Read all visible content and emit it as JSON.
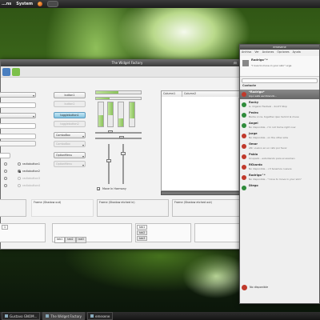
{
  "top_panel": {
    "menu_items": [
      "...ns",
      "System"
    ]
  },
  "taskbar": {
    "items": [
      {
        "label": "Gustavo GNOM..."
      },
      {
        "label": "The Widget Factory"
      },
      {
        "label": "emesene"
      }
    ]
  },
  "widget_factory": {
    "title": "The Widget Factory",
    "buttons": {
      "button1": "button1",
      "button2": "button2",
      "toggle1": "togglebutton1",
      "toggle2": "togglebutton2",
      "combo1": "ComboBox",
      "combo2": "ComboBox",
      "option1": "OptionMenu",
      "option2": "OptionMenu"
    },
    "radios": [
      "radiobutton1",
      "radiobutton2",
      "radiobutton3",
      "radiobutton4"
    ],
    "radio_selected_index": 1,
    "list_columns": [
      "Column1",
      "Column2"
    ],
    "move_checkbox": "Move In Harmony",
    "frames": [
      "Frame (Shadow out)",
      "Frame (Shadow etched in)",
      "Frame (Shadow etched out)"
    ],
    "tabs_a": [
      "tab1",
      "tab2",
      "tab3"
    ],
    "tabs_b": [
      "tab1",
      "tab2",
      "tab3"
    ],
    "tabs_c": [
      "tab1",
      "tab2",
      "tab3"
    ],
    "progress": 0.5
  },
  "pidgin": {
    "title": "emesene",
    "menu": [
      "Archivo",
      "Ver",
      "Acciones",
      "Opciones",
      "Ayuda"
    ],
    "status_text": "Rodrigo^*",
    "status_msg": "\"I love to move in your skin\" urge",
    "group": "Contacte",
    "contacts": [
      {
        "name": "*Rodrigo*",
        "msg": "Aquí está escribiendo...",
        "color": "#c0392b",
        "selected": true
      },
      {
        "name": "Rocky",
        "msg": "G. Organiz Festival - dont't Stop",
        "color": "#2e8b3a"
      },
      {
        "name": "Pedro",
        "msg": "Badre on la, together ipso hemnt la muse",
        "color": "#2e8b3a"
      },
      {
        "name": "Angel",
        "msg": "No disponible - i'm not home right now",
        "color": "#2e8b3a"
      },
      {
        "name": "Jorge",
        "msg": "No disponible - on the other side",
        "color": "#c0392b"
      },
      {
        "name": "Omar",
        "msg": "Afk: vuelvo en un rato por favor",
        "color": "#c0392b"
      },
      {
        "name": "Pablo",
        "msg": "Ocupado - estudiando para el examen",
        "color": "#c0392b"
      },
      {
        "name": "R€kardo",
        "msg": "No disponible - <3 tenemos nuevos",
        "color": "#c0392b"
      },
      {
        "name": "Rodrigo^*",
        "msg": "No disponible - \"I love to move in your skin\"",
        "color": "#c0392b"
      },
      {
        "name": "Diego",
        "msg": "",
        "color": "#2e8b3a"
      }
    ],
    "bottom_status": "No disponible"
  }
}
